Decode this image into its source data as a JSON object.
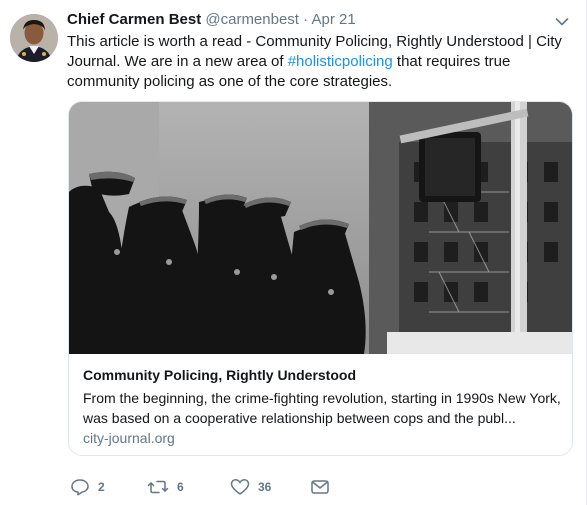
{
  "tweet": {
    "author_name": "Chief Carmen Best",
    "handle": "@carmenbest",
    "separator": "·",
    "time": "Apr 21",
    "text_before": "This article is worth a read - Community Policing, Rightly Understood | City Journal.                        We are in a new area of ",
    "hashtag": "#holisticpolicing",
    "text_after": " that requires true community policing as one of the core strategies."
  },
  "card": {
    "title": "Community Policing, Rightly Understood",
    "description": "From the beginning, the crime-fighting revolution, starting in 1990s New York, was based on a cooperative relationship between cops and the publ...",
    "domain": "city-journal.org"
  },
  "actions": {
    "reply_count": "2",
    "retweet_count": "6",
    "like_count": "36"
  },
  "icons": [
    "chevron-down-icon",
    "reply-icon",
    "retweet-icon",
    "like-icon",
    "direct-message-icon"
  ],
  "colors": {
    "link": "#1b95e0",
    "muted": "#657786",
    "text": "#14171a",
    "border": "#e1e8ed"
  }
}
